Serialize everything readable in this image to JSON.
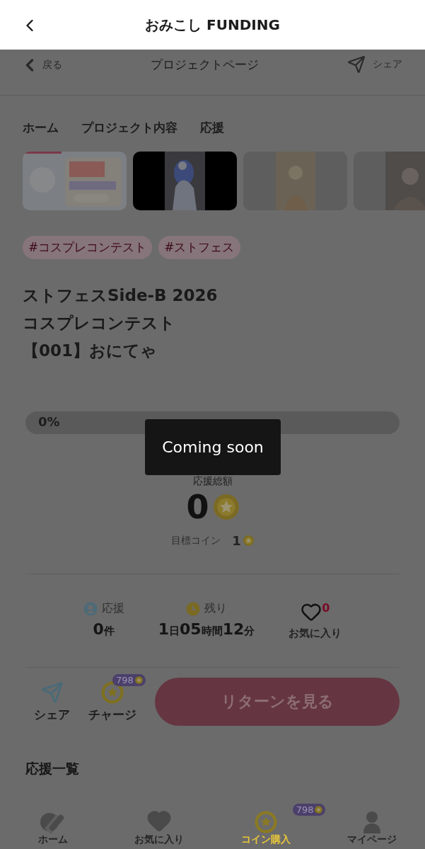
{
  "app_bar": {
    "title": "おみこし FUNDING"
  },
  "page_header": {
    "back": "戻る",
    "title": "プロジェクトページ",
    "share": "シェア"
  },
  "tabs": [
    {
      "label": "ホーム"
    },
    {
      "label": "プロジェクト内容"
    },
    {
      "label": "応援"
    }
  ],
  "gallery": [
    {
      "kind": "picture"
    },
    {
      "kind": "picture"
    },
    {
      "kind": "picture"
    },
    {
      "kind": "picture"
    }
  ],
  "tags": [
    "#コスプレコンテスト",
    "#ストフェス"
  ],
  "title_lines": [
    "ストフェスSide-B 2026",
    "コスプレコンテスト",
    "【001】おにてゃ"
  ],
  "progress": {
    "label": "0%",
    "level": 0
  },
  "total": {
    "label": "応援総額",
    "amount": "0"
  },
  "goal": {
    "label": "目標コイン",
    "amount": "1"
  },
  "stats": {
    "supporters": {
      "label": "応援",
      "value": "0",
      "unit": "件"
    },
    "remaining": {
      "label": "残り",
      "parts": [
        {
          "value": "1",
          "unit": "日"
        },
        {
          "value": "05",
          "unit": "時間"
        },
        {
          "value": "12",
          "unit": "分"
        }
      ]
    },
    "favorites": {
      "count": "0",
      "label": "お気に入り"
    }
  },
  "actions": {
    "share": "シェア",
    "charge": {
      "label": "チャージ",
      "balance": "798"
    },
    "primary": "リターンを見る"
  },
  "section_title": "応援一覧",
  "bottom_nav": [
    {
      "label": "ホーム",
      "selected": false
    },
    {
      "label": "お気に入り",
      "selected": false
    },
    {
      "label": "コイン購入",
      "badge": "798",
      "selected": true
    },
    {
      "label": "マイページ",
      "selected": false
    }
  ],
  "toast": "Coming soon"
}
